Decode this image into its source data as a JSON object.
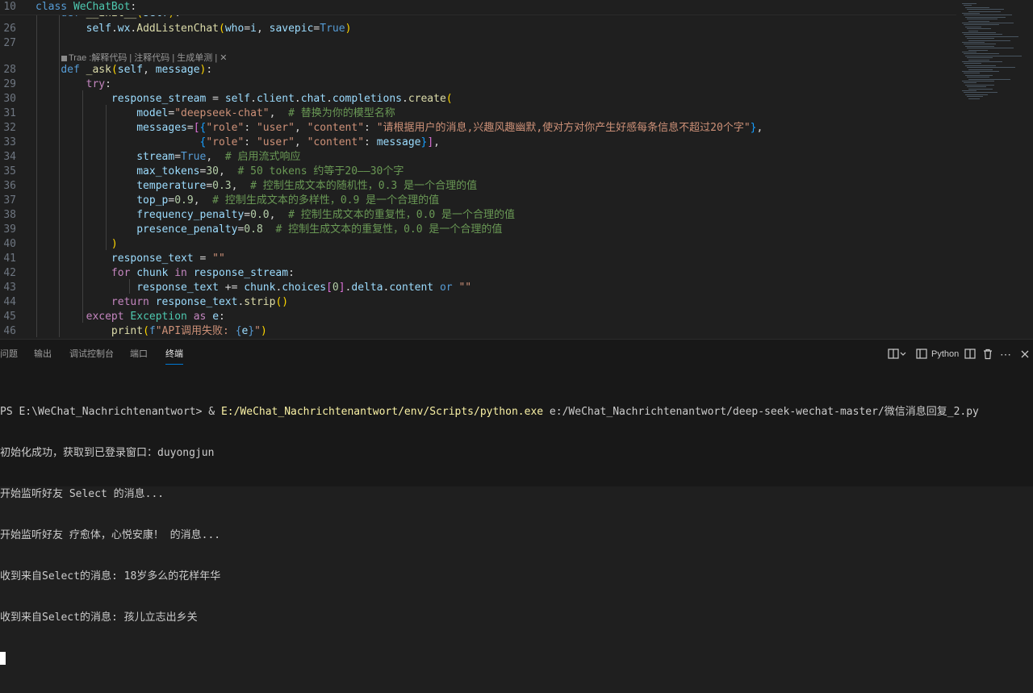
{
  "editor": {
    "sticky": [
      {
        "num": "10",
        "tokens": [
          [
            "kw",
            "class "
          ],
          [
            "cls",
            "WeChatBot"
          ],
          [
            "dft",
            ":"
          ]
        ]
      },
      {
        "num": "",
        "tokens": [
          [
            "dft",
            "    "
          ],
          [
            "kw",
            "def "
          ],
          [
            "fn",
            "__init__"
          ],
          [
            "par",
            "("
          ],
          [
            "var",
            "self"
          ],
          [
            "par",
            ")"
          ],
          [
            "dft",
            ":"
          ]
        ]
      }
    ],
    "lines": [
      {
        "num": "26",
        "tokens": [
          [
            "dft",
            "        "
          ],
          [
            "var",
            "self"
          ],
          [
            "dft",
            "."
          ],
          [
            "var",
            "wx"
          ],
          [
            "dft",
            "."
          ],
          [
            "fn",
            "AddListenChat"
          ],
          [
            "par",
            "("
          ],
          [
            "var",
            "who"
          ],
          [
            "dft",
            "="
          ],
          [
            "var",
            "i"
          ],
          [
            "dft",
            ", "
          ],
          [
            "var",
            "savepic"
          ],
          [
            "dft",
            "="
          ],
          [
            "kw",
            "True"
          ],
          [
            "par",
            ")"
          ]
        ]
      },
      {
        "num": "27",
        "tokens": []
      },
      {
        "num": "28",
        "tokens": [
          [
            "dft",
            "    "
          ],
          [
            "kw",
            "def "
          ],
          [
            "fn",
            "_ask"
          ],
          [
            "par",
            "("
          ],
          [
            "var",
            "self"
          ],
          [
            "dft",
            ", "
          ],
          [
            "var",
            "message"
          ],
          [
            "par",
            ")"
          ],
          [
            "dft",
            ":"
          ]
        ]
      },
      {
        "num": "29",
        "tokens": [
          [
            "dft",
            "        "
          ],
          [
            "kw2",
            "try"
          ],
          [
            "dft",
            ":"
          ]
        ]
      },
      {
        "num": "30",
        "tokens": [
          [
            "dft",
            "            "
          ],
          [
            "var",
            "response_stream"
          ],
          [
            "dft",
            " = "
          ],
          [
            "var",
            "self"
          ],
          [
            "dft",
            "."
          ],
          [
            "var",
            "client"
          ],
          [
            "dft",
            "."
          ],
          [
            "var",
            "chat"
          ],
          [
            "dft",
            "."
          ],
          [
            "var",
            "completions"
          ],
          [
            "dft",
            "."
          ],
          [
            "fn",
            "create"
          ],
          [
            "par",
            "("
          ]
        ]
      },
      {
        "num": "31",
        "tokens": [
          [
            "dft",
            "                "
          ],
          [
            "var",
            "model"
          ],
          [
            "dft",
            "="
          ],
          [
            "str",
            "\"deepseek-chat\""
          ],
          [
            "dft",
            ",  "
          ],
          [
            "cmt",
            "# 替换为你的模型名称"
          ]
        ]
      },
      {
        "num": "32",
        "tokens": [
          [
            "dft",
            "                "
          ],
          [
            "var",
            "messages"
          ],
          [
            "dft",
            "="
          ],
          [
            "brk",
            "["
          ],
          [
            "brc",
            "{"
          ],
          [
            "str",
            "\"role\""
          ],
          [
            "dft",
            ": "
          ],
          [
            "str",
            "\"user\""
          ],
          [
            "dft",
            ", "
          ],
          [
            "str",
            "\"content\""
          ],
          [
            "dft",
            ": "
          ],
          [
            "str",
            "\"请根据用户的消息,兴趣风趣幽默,使对方对你产生好感每条信息不超过20个字\""
          ],
          [
            "brc",
            "}"
          ],
          [
            "dft",
            ","
          ]
        ]
      },
      {
        "num": "33",
        "tokens": [
          [
            "dft",
            "                          "
          ],
          [
            "brc",
            "{"
          ],
          [
            "str",
            "\"role\""
          ],
          [
            "dft",
            ": "
          ],
          [
            "str",
            "\"user\""
          ],
          [
            "dft",
            ", "
          ],
          [
            "str",
            "\"content\""
          ],
          [
            "dft",
            ": "
          ],
          [
            "var",
            "message"
          ],
          [
            "brc",
            "}"
          ],
          [
            "brk",
            "]"
          ],
          [
            "dft",
            ","
          ]
        ]
      },
      {
        "num": "34",
        "tokens": [
          [
            "dft",
            "                "
          ],
          [
            "var",
            "stream"
          ],
          [
            "dft",
            "="
          ],
          [
            "kw",
            "True"
          ],
          [
            "dft",
            ",  "
          ],
          [
            "cmt",
            "# 启用流式响应"
          ]
        ]
      },
      {
        "num": "35",
        "tokens": [
          [
            "dft",
            "                "
          ],
          [
            "var",
            "max_tokens"
          ],
          [
            "dft",
            "="
          ],
          [
            "num",
            "30"
          ],
          [
            "dft",
            ",  "
          ],
          [
            "cmt",
            "# 50 tokens 约等于20——30个字"
          ]
        ]
      },
      {
        "num": "36",
        "tokens": [
          [
            "dft",
            "                "
          ],
          [
            "var",
            "temperature"
          ],
          [
            "dft",
            "="
          ],
          [
            "num",
            "0.3"
          ],
          [
            "dft",
            ",  "
          ],
          [
            "cmt",
            "# 控制生成文本的随机性，0.3 是一个合理的值"
          ]
        ]
      },
      {
        "num": "37",
        "tokens": [
          [
            "dft",
            "                "
          ],
          [
            "var",
            "top_p"
          ],
          [
            "dft",
            "="
          ],
          [
            "num",
            "0.9"
          ],
          [
            "dft",
            ",  "
          ],
          [
            "cmt",
            "# 控制生成文本的多样性，0.9 是一个合理的值"
          ]
        ]
      },
      {
        "num": "38",
        "tokens": [
          [
            "dft",
            "                "
          ],
          [
            "var",
            "frequency_penalty"
          ],
          [
            "dft",
            "="
          ],
          [
            "num",
            "0.0"
          ],
          [
            "dft",
            ",  "
          ],
          [
            "cmt",
            "# 控制生成文本的重复性，0.0 是一个合理的值"
          ]
        ]
      },
      {
        "num": "39",
        "tokens": [
          [
            "dft",
            "                "
          ],
          [
            "var",
            "presence_penalty"
          ],
          [
            "dft",
            "="
          ],
          [
            "num",
            "0.8"
          ],
          [
            "dft",
            "  "
          ],
          [
            "cmt",
            "# 控制生成文本的重复性，0.0 是一个合理的值"
          ]
        ]
      },
      {
        "num": "40",
        "tokens": [
          [
            "dft",
            "            "
          ],
          [
            "par",
            ")"
          ]
        ]
      },
      {
        "num": "41",
        "tokens": [
          [
            "dft",
            "            "
          ],
          [
            "var",
            "response_text"
          ],
          [
            "dft",
            " = "
          ],
          [
            "str",
            "\"\""
          ]
        ]
      },
      {
        "num": "42",
        "tokens": [
          [
            "dft",
            "            "
          ],
          [
            "kw2",
            "for "
          ],
          [
            "var",
            "chunk"
          ],
          [
            "kw2",
            " in "
          ],
          [
            "var",
            "response_stream"
          ],
          [
            "dft",
            ":"
          ]
        ]
      },
      {
        "num": "43",
        "tokens": [
          [
            "dft",
            "                "
          ],
          [
            "var",
            "response_text"
          ],
          [
            "dft",
            " += "
          ],
          [
            "var",
            "chunk"
          ],
          [
            "dft",
            "."
          ],
          [
            "var",
            "choices"
          ],
          [
            "brk",
            "["
          ],
          [
            "num",
            "0"
          ],
          [
            "brk",
            "]"
          ],
          [
            "dft",
            "."
          ],
          [
            "var",
            "delta"
          ],
          [
            "dft",
            "."
          ],
          [
            "var",
            "content"
          ],
          [
            "kw",
            " or "
          ],
          [
            "str",
            "\"\""
          ]
        ]
      },
      {
        "num": "44",
        "tokens": [
          [
            "dft",
            "            "
          ],
          [
            "kw2",
            "return "
          ],
          [
            "var",
            "response_text"
          ],
          [
            "dft",
            "."
          ],
          [
            "fn",
            "strip"
          ],
          [
            "par",
            "()"
          ]
        ]
      },
      {
        "num": "45",
        "tokens": [
          [
            "dft",
            "        "
          ],
          [
            "kw2",
            "except "
          ],
          [
            "cls",
            "Exception"
          ],
          [
            "kw2",
            " as "
          ],
          [
            "var",
            "e"
          ],
          [
            "dft",
            ":"
          ]
        ]
      },
      {
        "num": "46",
        "tokens": [
          [
            "dft",
            "            "
          ],
          [
            "fn",
            "print"
          ],
          [
            "par",
            "("
          ],
          [
            "kw",
            "f"
          ],
          [
            "str",
            "\"API调用失败: "
          ],
          [
            "kw",
            "{"
          ],
          [
            "var",
            "e"
          ],
          [
            "kw",
            "}"
          ],
          [
            "str",
            "\""
          ],
          [
            "par",
            ")"
          ]
        ]
      }
    ],
    "codelens": "Trae :解释代码 | 注释代码 | 生成单测 | ✕"
  },
  "panel": {
    "tabs": [
      {
        "label": "问题",
        "active": false
      },
      {
        "label": "输出",
        "active": false
      },
      {
        "label": "调试控制台",
        "active": false
      },
      {
        "label": "端口",
        "active": false
      },
      {
        "label": "终端",
        "active": true
      }
    ],
    "actions": {
      "shell_label": "Python",
      "icons": [
        "split-layout-icon",
        "python-terminal-icon",
        "split-terminal-icon",
        "trash-icon",
        "more-icon",
        "close-icon"
      ]
    }
  },
  "terminal": {
    "prompt": "PS E:\\WeChat_Nachrichtenantwort> & ",
    "command": "E:/WeChat_Nachrichtenantwort/env/Scripts/python.exe",
    "args": " e:/WeChat_Nachrichtenantwort/deep-seek-wechat-master/微信消息回复_2.py",
    "output": [
      "初始化成功，获取到已登录窗口：duyongjun",
      "开始监听好友 Select 的消息...",
      "开始监听好友 疗愈体，心悦安康！ 的消息...",
      "收到来自Select的消息: 18岁多么的花样年华",
      "收到来自Select的消息: 孩儿立志出乡关"
    ]
  }
}
